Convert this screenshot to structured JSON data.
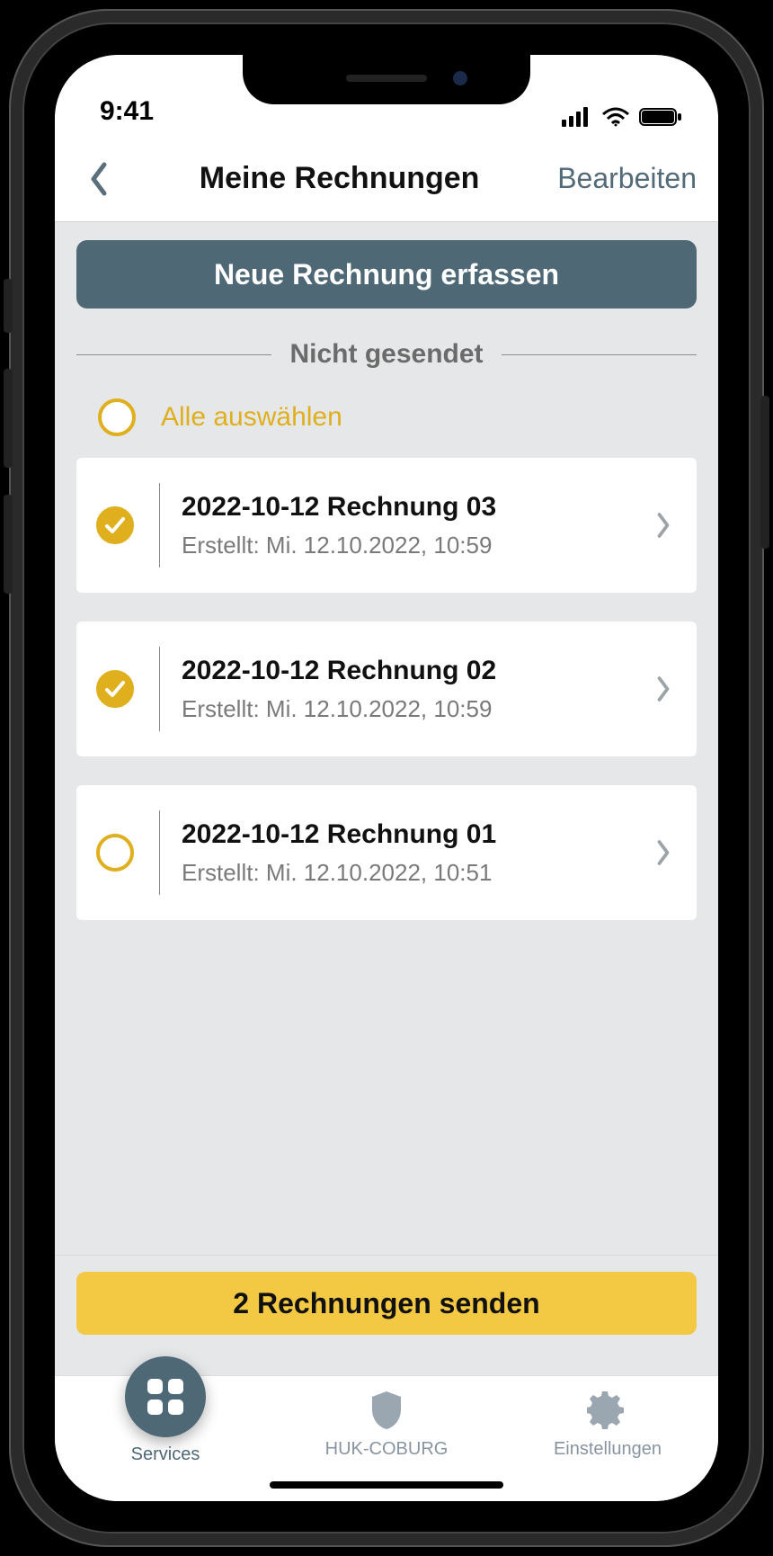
{
  "status": {
    "time": "9:41"
  },
  "nav": {
    "title": "Meine Rechnungen",
    "edit": "Bearbeiten"
  },
  "primary_button": "Neue Rechnung erfassen",
  "section": {
    "not_sent": "Nicht gesendet"
  },
  "select_all_label": "Alle auswählen",
  "invoices": [
    {
      "title": "2022-10-12 Rechnung 03",
      "sub": "Erstellt: Mi. 12.10.2022, 10:59",
      "selected": true
    },
    {
      "title": "2022-10-12 Rechnung 02",
      "sub": "Erstellt: Mi. 12.10.2022, 10:59",
      "selected": true
    },
    {
      "title": "2022-10-12 Rechnung 01",
      "sub": "Erstellt: Mi. 12.10.2022, 10:51",
      "selected": false
    }
  ],
  "send_button": "2 Rechnungen senden",
  "tabs": {
    "services": "Services",
    "huk": "HUK-COBURG",
    "settings": "Einstellungen"
  }
}
